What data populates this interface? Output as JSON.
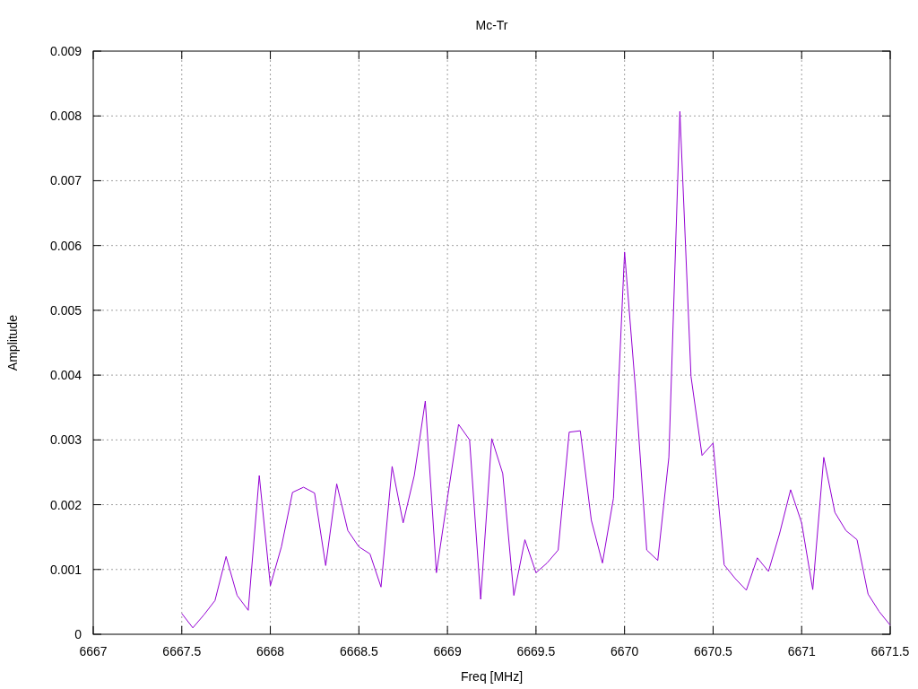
{
  "chart_data": {
    "type": "line",
    "title": "Mc-Tr",
    "xlabel": "Freq [MHz]",
    "ylabel": "Amplitude",
    "x": [
      6667.5,
      6667.5625,
      6667.625,
      6667.6875,
      6667.75,
      6667.8125,
      6667.875,
      6667.9375,
      6668,
      6668.0625,
      6668.125,
      6668.1875,
      6668.25,
      6668.3125,
      6668.375,
      6668.4375,
      6668.5,
      6668.5625,
      6668.625,
      6668.6875,
      6668.75,
      6668.8125,
      6668.875,
      6668.9375,
      6669,
      6669.0625,
      6669.125,
      6669.1875,
      6669.25,
      6669.3125,
      6669.375,
      6669.4375,
      6669.5,
      6669.5625,
      6669.625,
      6669.6875,
      6669.75,
      6669.8125,
      6669.875,
      6669.9375,
      6670,
      6670.0625,
      6670.125,
      6670.1875,
      6670.25,
      6670.3125,
      6670.375,
      6670.4375,
      6670.5,
      6670.5625,
      6670.625,
      6670.6875,
      6670.75,
      6670.8125,
      6670.875,
      6670.9375,
      6671,
      6671.0625,
      6671.125,
      6671.1875,
      6671.25,
      6671.3125,
      6671.375,
      6671.4375,
      6671.5
    ],
    "series": [
      {
        "color": "#9400d3",
        "values": [
          0.00032,
          0.0001,
          0.0003,
          0.00052,
          0.0012,
          0.0006,
          0.00037,
          0.00245,
          0.00075,
          0.00135,
          0.00219,
          0.00227,
          0.00218,
          0.00106,
          0.00232,
          0.0016,
          0.00135,
          0.00124,
          0.00073,
          0.00259,
          0.00172,
          0.00245,
          0.0036,
          0.00095,
          0.0021,
          0.00324,
          0.003,
          0.00054,
          0.00302,
          0.00248,
          0.0006,
          0.00146,
          0.00095,
          0.0011,
          0.0013,
          0.00312,
          0.00314,
          0.00176,
          0.0011,
          0.0021,
          0.0059,
          0.00376,
          0.0013,
          0.00114,
          0.00273,
          0.00807,
          0.00398,
          0.00276,
          0.00295,
          0.00107,
          0.00086,
          0.00068,
          0.00118,
          0.00097,
          0.00155,
          0.00223,
          0.00172,
          0.00069,
          0.00273,
          0.00188,
          0.0016,
          0.00146,
          0.00062,
          0.00035,
          0.00014
        ]
      }
    ],
    "grid": true,
    "xlim": [
      6667,
      6671.5
    ],
    "ylim": [
      0,
      0.009
    ],
    "xticks": [
      6667,
      6667.5,
      6668,
      6668.5,
      6669,
      6669.5,
      6670,
      6670.5,
      6671,
      6671.5
    ],
    "yticks": [
      0,
      0.001,
      0.002,
      0.003,
      0.004,
      0.005,
      0.006,
      0.007,
      0.008,
      0.009
    ]
  }
}
